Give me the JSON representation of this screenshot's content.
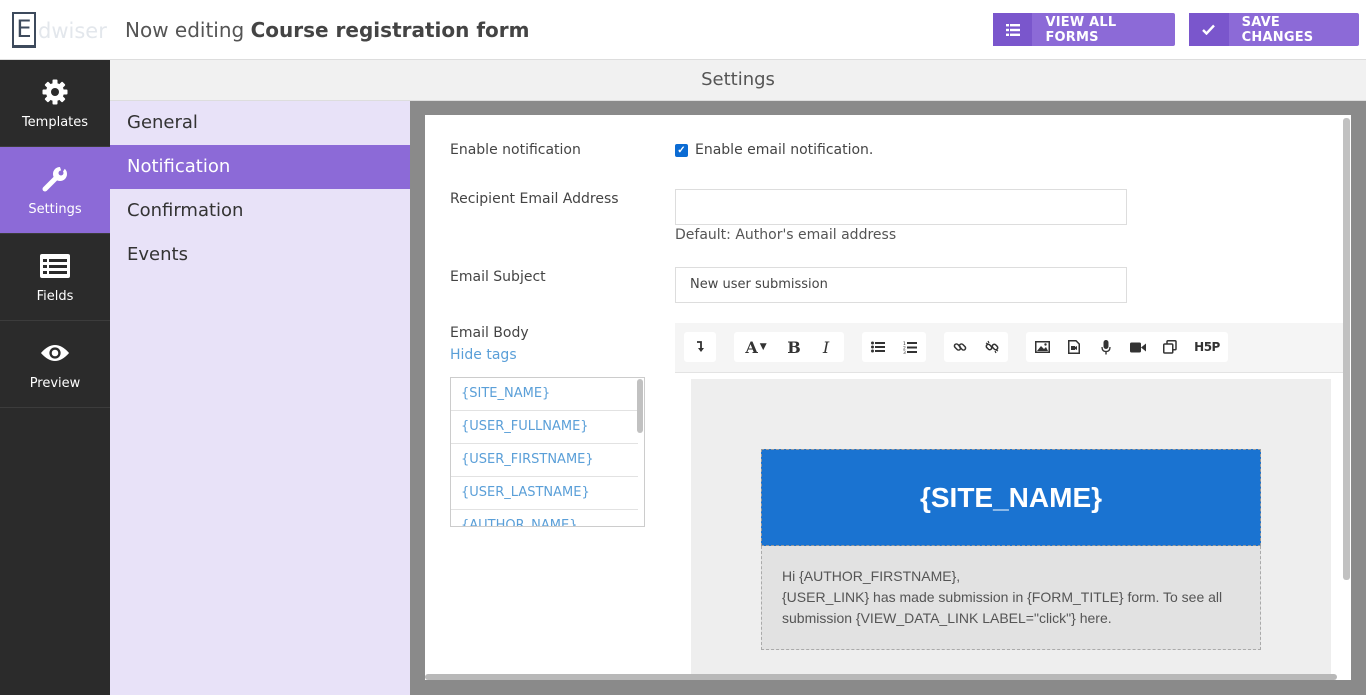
{
  "header": {
    "logo_letter": "E",
    "logo_rest": "dwiser",
    "editing_prefix": "Now editing",
    "form_title": "Course registration form",
    "view_all_label": "VIEW ALL FORMS",
    "save_label": "SAVE CHANGES"
  },
  "leftnav": [
    {
      "label": "Templates",
      "icon": "gear-icon"
    },
    {
      "label": "Settings",
      "icon": "wrench-icon",
      "active": true
    },
    {
      "label": "Fields",
      "icon": "list-icon"
    },
    {
      "label": "Preview",
      "icon": "eye-icon"
    }
  ],
  "settings_title": "Settings",
  "subnav": [
    {
      "label": "General"
    },
    {
      "label": "Notification",
      "active": true
    },
    {
      "label": "Confirmation"
    },
    {
      "label": "Events"
    }
  ],
  "form": {
    "enable_label": "Enable notification",
    "enable_checkbox_label": "Enable email notification.",
    "enable_checked": true,
    "recipient_label": "Recipient Email Address",
    "recipient_value": "",
    "recipient_hint": "Default: Author's email address",
    "subject_label": "Email Subject",
    "subject_value": "New user submission",
    "body_label": "Email Body",
    "hide_tags_label": "Hide tags",
    "tags": [
      "{SITE_NAME}",
      "{USER_FULLNAME}",
      "{USER_FIRSTNAME}",
      "{USER_LASTNAME}",
      "{AUTHOR_NAME}"
    ]
  },
  "editor": {
    "toolbar_icons": [
      "collapse-icon",
      "font-color-icon",
      "bold-icon",
      "italic-icon",
      "bullet-list-icon",
      "numbered-list-icon",
      "link-icon",
      "unlink-icon",
      "image-icon",
      "media-icon",
      "microphone-icon",
      "video-icon",
      "copy-icon",
      "h5p-icon"
    ],
    "h5p_label": "H5P",
    "email_header": "{SITE_NAME}",
    "email_line1": "Hi {AUTHOR_FIRSTNAME},",
    "email_line2": "{USER_LINK} has made submission in {FORM_TITLE} form. To see all submission {VIEW_DATA_LINK LABEL=\"click\"} here."
  },
  "colors": {
    "accent": "#8c6ad7",
    "sidebar": "#2b2b2b",
    "subnav_bg": "#e8e2f8",
    "email_header_bg": "#1a73d1",
    "link": "#5a9fd8"
  }
}
